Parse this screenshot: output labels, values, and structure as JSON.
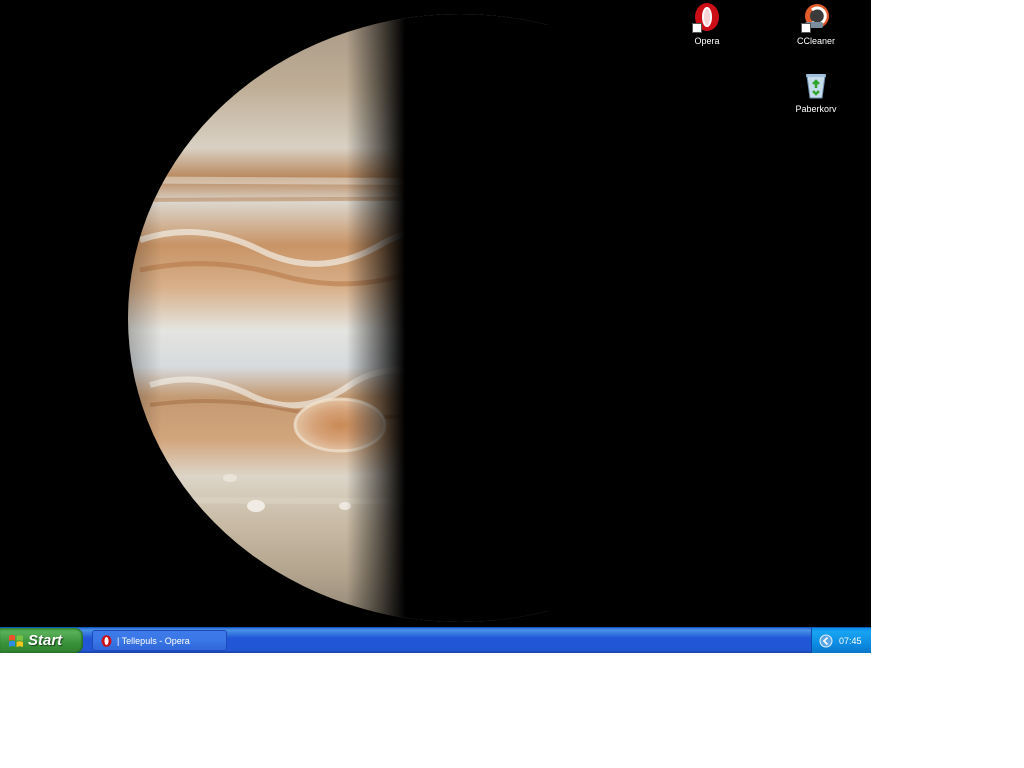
{
  "desktop": {
    "icons": [
      {
        "label": "Opera",
        "icon": "opera-icon"
      },
      {
        "label": "CCleaner",
        "icon": "ccleaner-icon"
      },
      {
        "label": "Paberkorv",
        "icon": "recycle-bin-icon"
      }
    ]
  },
  "taskbar": {
    "start_label": "Start",
    "task_label": "| Tellepuls - Opera",
    "clock": "07:45"
  },
  "colors": {
    "taskbar_blue": "#2157d7",
    "start_green": "#3a933a",
    "tray_blue": "#0b88e0",
    "desktop_background": "#000000",
    "opera_red": "#cc0f16"
  }
}
